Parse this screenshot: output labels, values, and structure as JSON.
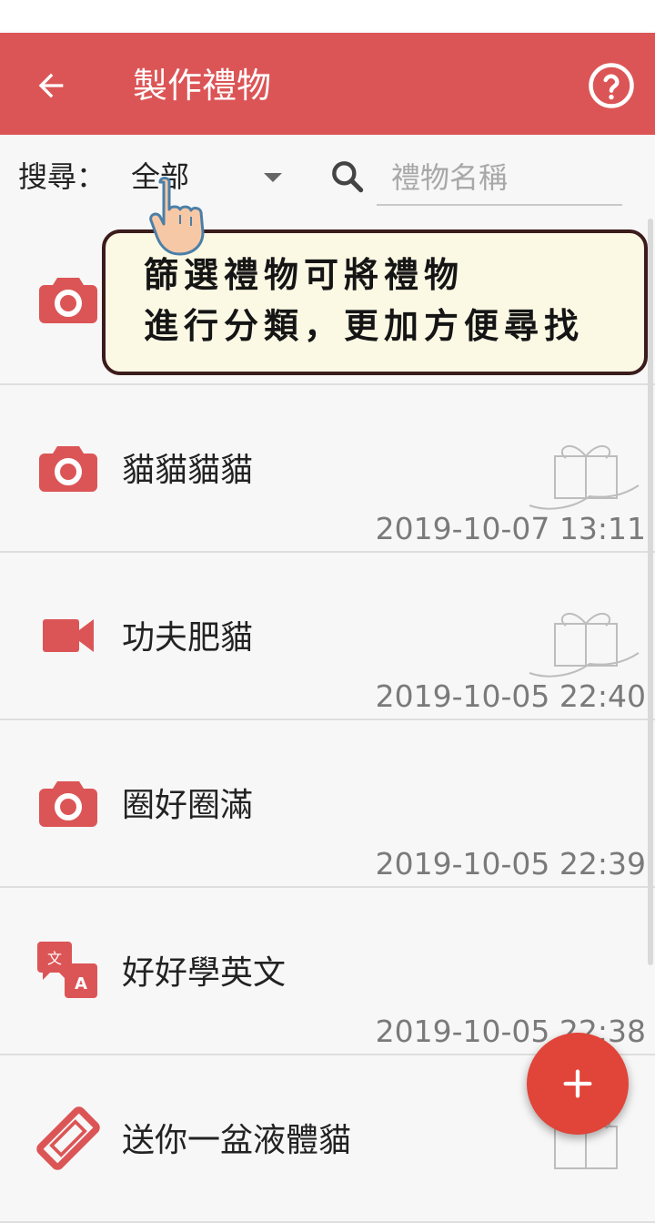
{
  "appbar": {
    "title": "製作禮物",
    "back_icon": "arrow-back-icon",
    "help_icon": "help-circle-icon",
    "color": "#dc5556"
  },
  "filter": {
    "label": "搜尋：",
    "selected": "全部",
    "search_placeholder": "禮物名稱",
    "search_value": ""
  },
  "gifts": [
    {
      "name": "",
      "date": "",
      "icon": "camera-icon"
    },
    {
      "name": "貓貓貓貓",
      "date": "2019-10-07 13:11",
      "icon": "camera-icon",
      "gift_image": true
    },
    {
      "name": "功夫肥貓",
      "date": "2019-10-05 22:40",
      "icon": "videocam-icon",
      "gift_image": true
    },
    {
      "name": "圈好圈滿",
      "date": "2019-10-05 22:39",
      "icon": "camera-icon",
      "gift_image": false
    },
    {
      "name": "好好學英文",
      "date": "2019-10-05 22:38",
      "icon": "translate-icon",
      "gift_image": false
    },
    {
      "name": "送你一盆液體貓",
      "date": "",
      "icon": "ticket-icon",
      "gift_image": true
    }
  ],
  "tooltip": {
    "line1": "篩選禮物可將禮物",
    "line2": "進行分類，更加方便尋找"
  },
  "fab": {
    "icon": "add-icon",
    "color": "#e14438"
  },
  "accent_icon_color": "#dc5556"
}
